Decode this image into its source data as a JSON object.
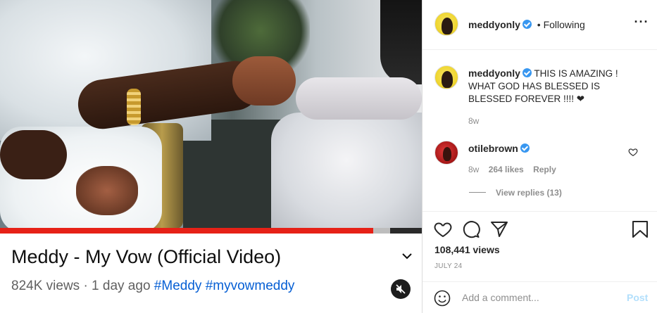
{
  "video": {
    "title": "Meddy - My Vow (Official Video)",
    "views": "824K views · 1 day ago",
    "hashtags": [
      "#Meddy",
      "#myvowmeddy"
    ],
    "progress_fraction": 0.885,
    "buffer_fraction": 0.04,
    "colors": {
      "progress": "#e62117",
      "link": "#065fd4"
    }
  },
  "post": {
    "author": "meddyonly",
    "follow_status": "• Following",
    "caption": "THIS IS AMAZING ! WHAT GOD HAS BLESSED IS BLESSED FOREVER !!!! ❤",
    "caption_time": "8w",
    "comment": {
      "author": "otilebrown",
      "text": "",
      "time": "8w",
      "likes": "264 likes",
      "reply_label": "Reply",
      "view_replies": "View replies (13)"
    },
    "likes": "108,441 views",
    "date": "JULY 24",
    "add_comment_placeholder": "Add a comment...",
    "post_label": "Post",
    "icons": [
      "heart-icon",
      "comment-icon",
      "share-icon",
      "bookmark-icon",
      "more-options-icon",
      "emoji-icon",
      "verified-icon"
    ],
    "colors": {
      "verified": "#3897f0",
      "post_button": "#b2dffc"
    }
  }
}
